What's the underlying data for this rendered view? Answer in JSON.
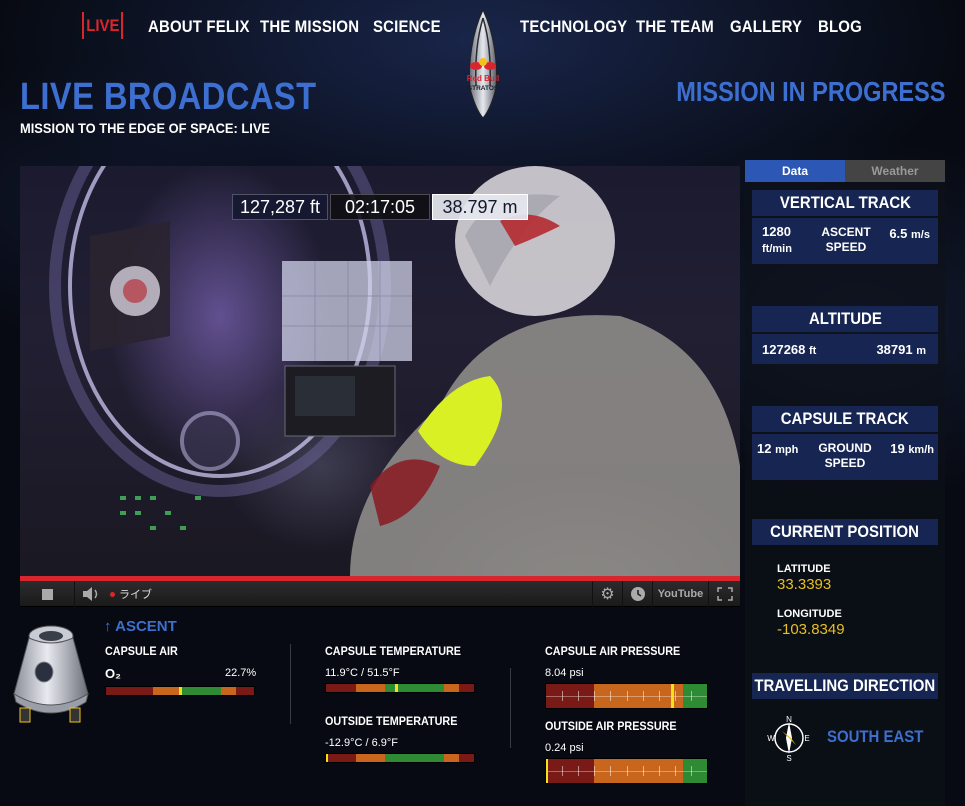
{
  "nav": {
    "live": "LIVE",
    "items": [
      "ABOUT FELIX",
      "THE MISSION",
      "SCIENCE",
      "TECHNOLOGY",
      "THE TEAM",
      "GALLERY",
      "BLOG"
    ]
  },
  "brand": {
    "line1": "Red Bull",
    "line2": "STRATOS"
  },
  "header": {
    "title": "LIVE BROADCAST",
    "subtitle": "MISSION TO THE EDGE OF SPACE: LIVE",
    "status": "MISSION IN PROGRESS"
  },
  "video": {
    "altitude_ft": "127,287 ft",
    "elapsed": "02:17:05",
    "altitude_m": "38.797 m",
    "live_label": "ライブ",
    "youtube_label": "YouTube",
    "progress": 1.0
  },
  "telemetry": {
    "phase": "ASCENT",
    "capsule_air": {
      "label": "CAPSULE AIR",
      "gas": "O₂",
      "value": "22.7%",
      "level": 0.5
    },
    "capsule_temperature": {
      "label": "CAPSULE TEMPERATURE",
      "value": "11.9°C / 51.5°F",
      "level": 0.47
    },
    "outside_temperature": {
      "label": "OUTSIDE TEMPERATURE",
      "value": "-12.9°C / 6.9°F",
      "level": 0.0
    },
    "capsule_air_pressure": {
      "label": "CAPSULE AIR PRESSURE",
      "value": "8.04 psi",
      "level": 0.78
    },
    "outside_air_pressure": {
      "label": "OUTSIDE AIR PRESSURE",
      "value": "0.24 psi",
      "level": 0.0
    }
  },
  "side": {
    "tabs": [
      "Data",
      "Weather"
    ],
    "vertical_track": {
      "title": "VERTICAL TRACK",
      "left_value": "1280",
      "left_unit": "ft/min",
      "center": "ASCENT SPEED",
      "right_value": "6.5",
      "right_unit": "m/s"
    },
    "altitude": {
      "title": "ALTITUDE",
      "left_value": "127268",
      "left_unit": "ft",
      "right_value": "38791",
      "right_unit": "m"
    },
    "capsule_track": {
      "title": "CAPSULE TRACK",
      "left_value": "12",
      "left_unit": "mph",
      "center": "GROUND SPEED",
      "right_value": "19",
      "right_unit": "km/h"
    },
    "position": {
      "title": "CURRENT POSITION",
      "lat_label": "LATITUDE",
      "lat": "33.3393",
      "lon_label": "LONGITUDE",
      "lon": "-103.8349"
    },
    "direction": {
      "title": "TRAVELLING DIRECTION",
      "value": "SOUTH EAST",
      "compass": [
        "N",
        "E",
        "S",
        "W"
      ]
    }
  },
  "colors": {
    "accent": "#3d6fd0",
    "live": "#d8262f",
    "gold": "#e8bf24",
    "panel": "#162552"
  }
}
